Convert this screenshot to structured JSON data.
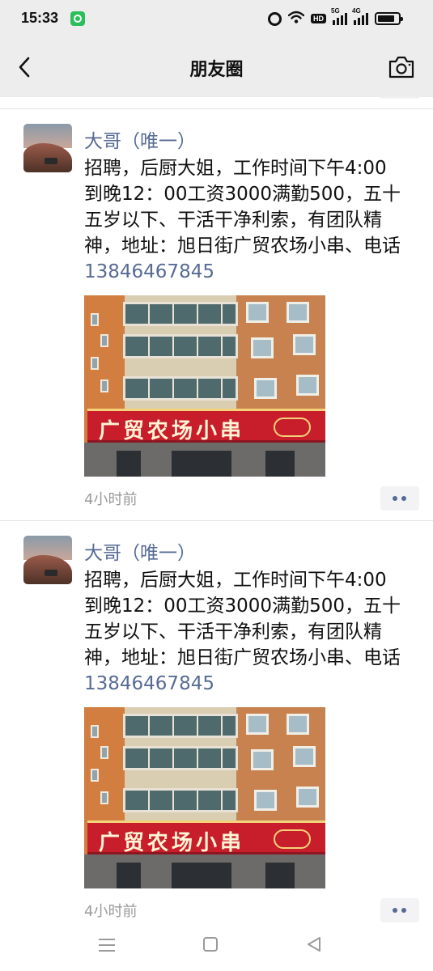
{
  "status_bar": {
    "time": "15:33",
    "hd_label": "HD",
    "signal_1_tag": "5G",
    "signal_2_tag": "4G",
    "icons": [
      "app-notification-icon",
      "alarm-icon",
      "wifi-icon",
      "hd-icon",
      "signal-5g-icon",
      "signal-4g-icon",
      "battery-icon"
    ]
  },
  "header": {
    "title": "朋友圈",
    "back_icon": "chevron-left-icon",
    "camera_icon": "camera-icon"
  },
  "posts": [
    {
      "author": "大哥（唯一）",
      "text": "招聘，后厨大姐，工作时间下午4:00到晚12：00工资3000满勤500，五十五岁以下、干活干净利索，有团队精神，地址：旭日街广贸农场小串、电话",
      "phone": "13846467845",
      "photo_sign": "广贸农场小串",
      "time_ago": "4小时前"
    },
    {
      "author": "大哥（唯一）",
      "text": "招聘，后厨大姐，工作时间下午4:00到晚12：00工资3000满勤500，五十五岁以下、干活干净利索，有团队精神，地址：旭日街广贸农场小串、电话",
      "phone": "13846467845",
      "photo_sign": "广贸农场小串",
      "time_ago": "4小时前"
    }
  ],
  "colors": {
    "header_bg": "#ededed",
    "link_blue": "#576b95",
    "timestamp_gray": "#9a9a9a",
    "sign_red": "#c81e2b"
  },
  "nav_bar": {
    "icons": [
      "menu-icon",
      "home-icon",
      "back-triangle-icon"
    ]
  }
}
